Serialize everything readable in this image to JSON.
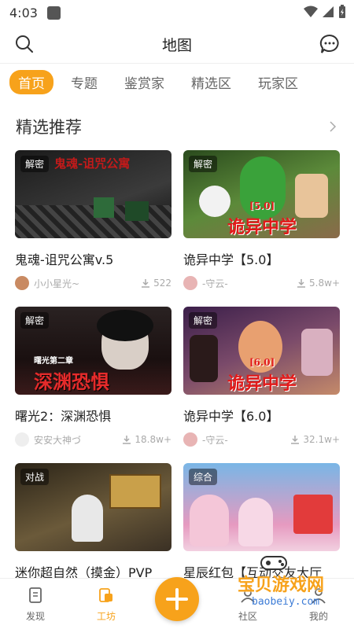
{
  "status": {
    "time": "4:03"
  },
  "header": {
    "title": "地图"
  },
  "tabs": [
    "首页",
    "专题",
    "鉴赏家",
    "精选区",
    "玩家区"
  ],
  "section": {
    "title": "精选推荐"
  },
  "cards": [
    {
      "tag": "解密",
      "image_text": "鬼魂-诅咒公寓",
      "title": "鬼魂-诅咒公寓v.5",
      "author": "小小星光~",
      "downloads": "522",
      "colors": [
        "#1b1b1b",
        "#3b3b3b"
      ]
    },
    {
      "tag": "解密",
      "image_text": "诡异中学",
      "image_sub": "[5.0]",
      "title": "诡异中学【5.0】",
      "author": "-守云-",
      "downloads": "5.8w+",
      "colors": [
        "#2a4a1d",
        "#5c8a3a"
      ]
    },
    {
      "tag": "解密",
      "image_text": "深渊恐惧",
      "image_sub": "曙光第二章",
      "title": "曙光2：深渊恐惧",
      "author": "安安大神づ",
      "downloads": "18.8w+",
      "colors": [
        "#1a1010",
        "#4a2222"
      ]
    },
    {
      "tag": "解密",
      "image_text": "诡异中学",
      "image_sub": "[6.0]",
      "title": "诡异中学【6.0】",
      "author": "-守云-",
      "downloads": "32.1w+",
      "colors": [
        "#3b1f4a",
        "#7a4a6a"
      ]
    },
    {
      "tag": "对战",
      "image_text": "",
      "title": "迷你超自然（摸金）PVP",
      "author": "",
      "downloads": "",
      "colors": [
        "#2b2418",
        "#6b5a3a"
      ]
    },
    {
      "tag": "综合",
      "image_text": "",
      "title": "星辰红包【互动交友大厅",
      "author": "",
      "downloads": "",
      "colors": [
        "#79b6e6",
        "#e69ac0"
      ]
    }
  ],
  "bottom_nav": [
    {
      "label": "发现",
      "icon": "discover-icon"
    },
    {
      "label": "工坊",
      "icon": "workshop-icon"
    },
    {
      "label": "",
      "icon": "add-icon"
    },
    {
      "label": "社区",
      "icon": "community-icon"
    },
    {
      "label": "我的",
      "icon": "profile-icon"
    }
  ],
  "watermark": {
    "main": "宝贝游戏网",
    "sub": "baobeiy.com"
  },
  "accent": "#f7a21b"
}
